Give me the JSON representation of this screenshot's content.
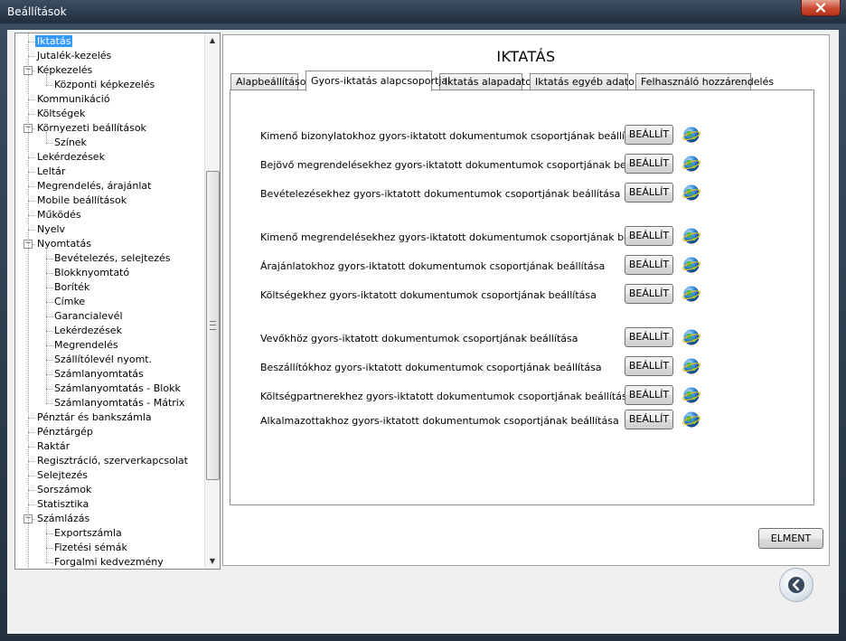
{
  "window": {
    "title": "Beállítások"
  },
  "tree": {
    "items": [
      {
        "label": "Iktatás",
        "level": 0,
        "selected": true
      },
      {
        "label": "Jutalék-kezelés",
        "level": 0
      },
      {
        "label": "Képkezelés",
        "level": 0,
        "expanded": true
      },
      {
        "label": "Központi képkezelés",
        "level": 1
      },
      {
        "label": "Kommunikáció",
        "level": 0
      },
      {
        "label": "Költségek",
        "level": 0
      },
      {
        "label": "Környezeti beállítások",
        "level": 0,
        "expanded": true
      },
      {
        "label": "Színek",
        "level": 1
      },
      {
        "label": "Lekérdezések",
        "level": 0
      },
      {
        "label": "Leltár",
        "level": 0
      },
      {
        "label": "Megrendelés, árajánlat",
        "level": 0
      },
      {
        "label": "Mobile beállítások",
        "level": 0
      },
      {
        "label": "Működés",
        "level": 0
      },
      {
        "label": "Nyelv",
        "level": 0
      },
      {
        "label": "Nyomtatás",
        "level": 0,
        "expanded": true
      },
      {
        "label": "Bevételezés, selejtezés",
        "level": 1
      },
      {
        "label": "Blokknyomtató",
        "level": 1
      },
      {
        "label": "Boríték",
        "level": 1
      },
      {
        "label": "Címke",
        "level": 1
      },
      {
        "label": "Garancialevél",
        "level": 1
      },
      {
        "label": "Lekérdezések",
        "level": 1
      },
      {
        "label": "Megrendelés",
        "level": 1
      },
      {
        "label": "Szállítólevél nyomt.",
        "level": 1
      },
      {
        "label": "Számlanyomtatás",
        "level": 1
      },
      {
        "label": "Számlanyomtatás - Blokk",
        "level": 1
      },
      {
        "label": "Számlanyomtatás - Mátrix",
        "level": 1
      },
      {
        "label": "Pénztár és bankszámla",
        "level": 0
      },
      {
        "label": "Pénztárgép",
        "level": 0
      },
      {
        "label": "Raktár",
        "level": 0
      },
      {
        "label": "Regisztráció, szerverkapcsolat",
        "level": 0
      },
      {
        "label": "Selejtezés",
        "level": 0
      },
      {
        "label": "Sorszámok",
        "level": 0
      },
      {
        "label": "Statisztika",
        "level": 0
      },
      {
        "label": "Számlázás",
        "level": 0,
        "expanded": true
      },
      {
        "label": "Exportszámla",
        "level": 1
      },
      {
        "label": "Fizetési sémák",
        "level": 1
      },
      {
        "label": "Forgalmi kedvezmény",
        "level": 1
      }
    ]
  },
  "panel": {
    "title": "IKTATÁS",
    "tabs": [
      {
        "label": "Alapbeállítások",
        "active": false
      },
      {
        "label": "Gyors-iktatás alapcsoportjai",
        "active": true
      },
      {
        "label": "Iktatás alapadatok",
        "active": false
      },
      {
        "label": "Iktatás egyéb adatok",
        "active": false
      },
      {
        "label": "Felhasználó hozzárendelés",
        "active": false
      }
    ],
    "button_label": "BEÁLLÍT",
    "rows": [
      "Kimenő bizonylatokhoz gyors-iktatott dokumentumok csoportjának beállítása",
      "Bejövő megrendelésekhez gyors-iktatott dokumentumok csoportjának beállítása",
      "Bevételezésekhez gyors-iktatott dokumentumok csoportjának beállítása",
      "Kimenő megrendelésekhez gyors-iktatott dokumentumok csoportjának beállítása",
      "Árajánlatokhoz gyors-iktatott dokumentumok csoportjának beállítása",
      "Költségekhez gyors-iktatott dokumentumok csoportjának beállítása",
      "Vevőkhöz gyors-iktatott dokumentumok csoportjának beállítása",
      "Beszállítókhoz gyors-iktatott dokumentumok csoportjának beállítása",
      "Költségpartnerekhez gyors-iktatott dokumentumok csoportjának beállítása",
      "Alkalmazottakhoz gyors-iktatott dokumentumok csoportjának beállítása"
    ],
    "save_label": "ELMENT"
  },
  "icons": {
    "row_icon": "globe-icon",
    "back": "back-arrow-icon",
    "close": "close-icon"
  },
  "colors": {
    "selection": "#3399ff",
    "titlebar": "#2b3a4c",
    "close_button": "#c9492f"
  }
}
